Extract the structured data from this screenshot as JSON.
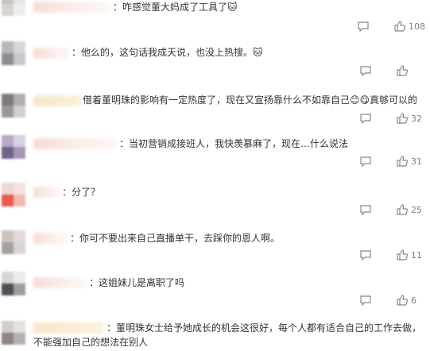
{
  "comments": [
    {
      "text": "：咋感觉董大妈成了工具了",
      "emoji": "🐱",
      "likes": "108"
    },
    {
      "text": "：他么的，这句话我成天说，也没上热搜。",
      "emoji": "🐱",
      "likes": ""
    },
    {
      "text": "借着董明珠的影响有一定热度了，现在又宣扬靠什么不如靠自己",
      "emoji": "😊😋",
      "tail": "真够可以的",
      "likes": "32"
    },
    {
      "text": "：当初营销成接班人，我快羡慕麻了，现在…什么说法",
      "emoji": "",
      "likes": "31"
    },
    {
      "text": "：分了？",
      "emoji": "",
      "likes": "25"
    },
    {
      "text": "：你可不要出来自己直播单干，去踩你的恩人啊。",
      "emoji": "",
      "likes": "11"
    },
    {
      "text": "：这姐妹儿是离职了吗",
      "emoji": "",
      "likes": "6"
    },
    {
      "text": "：董明珠女士给予她成长的机会这很好，每个人都有适合自己的工作去做，不能强加自己的想法在别人",
      "emoji": "",
      "likes": ""
    }
  ],
  "icons": {
    "reply": "comment-icon",
    "like": "thumbs-up-icon"
  },
  "colors": {
    "text": "#333333",
    "meta": "#808080",
    "name_blur": "#f6dbd6"
  }
}
